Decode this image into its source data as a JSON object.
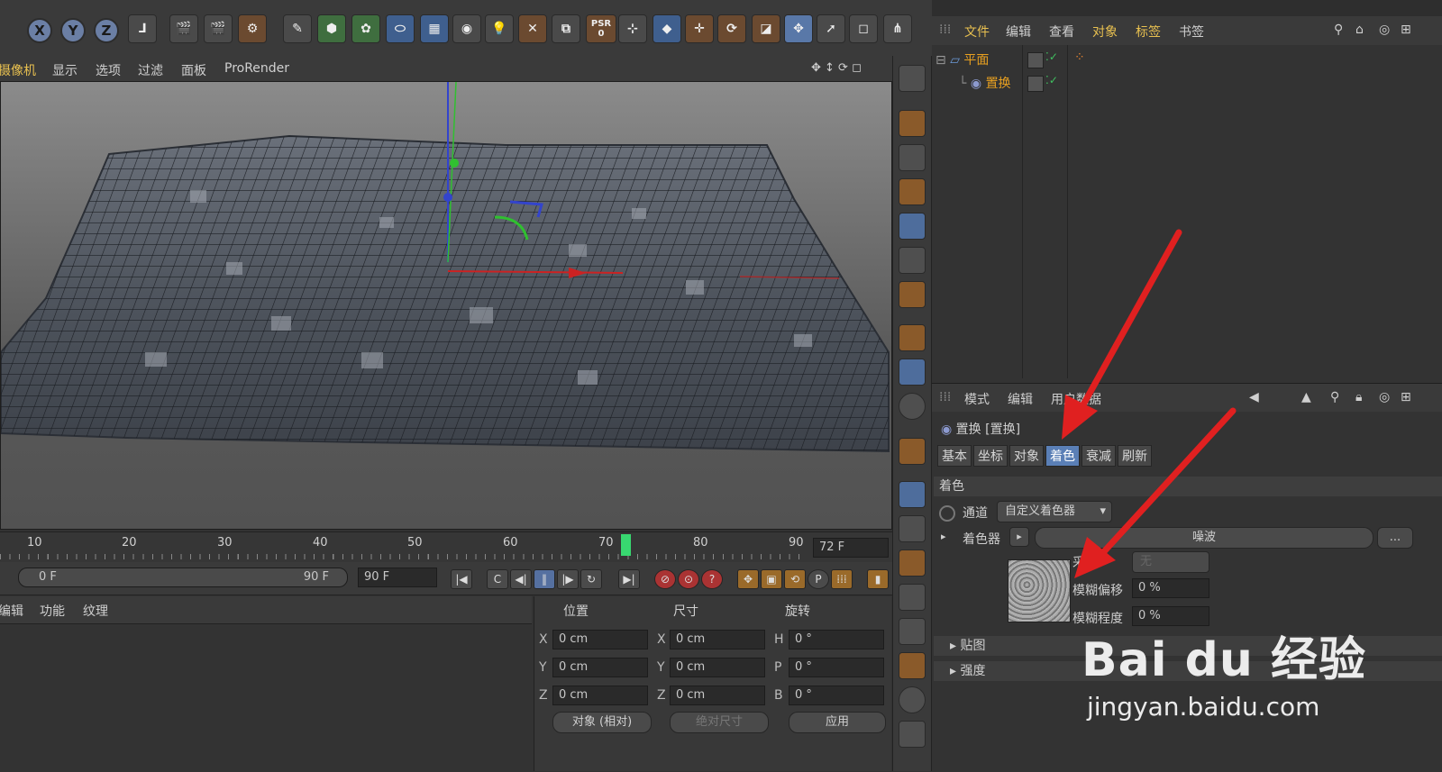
{
  "top_toolbar": {
    "axis_buttons": [
      "X",
      "Y",
      "Z"
    ],
    "psr_label": "PSR",
    "psr_value": "0",
    "tool_icons": [
      "coordinate-icon",
      "clapper-icon",
      "clapper-record-icon",
      "clapper-settings-icon",
      "pen-icon",
      "cube-green-icon",
      "flower-icon",
      "capsule-icon",
      "grid-icon",
      "camera-icon",
      "light-icon",
      "snap-icon",
      "uv-icon",
      "psr-icon",
      "xyz-axis-icon",
      "cube-blue-icon",
      "move-icon",
      "rotate-icon",
      "scale-icon",
      "move-alt-icon",
      "select-icon",
      "rect-select-icon",
      "hair-icon"
    ]
  },
  "viewport_menu": {
    "items": [
      "摄像机",
      "显示",
      "选项",
      "过滤",
      "面板",
      "ProRender"
    ]
  },
  "timeline": {
    "ticks": [
      "10",
      "20",
      "30",
      "40",
      "50",
      "60",
      "70",
      "80",
      "90"
    ],
    "playhead": 72,
    "current_frame": "72 F"
  },
  "transport": {
    "start_field": "0 F",
    "end_field": "90 F",
    "end_frame_field": "90 F",
    "buttons": [
      "|◀",
      "C",
      "◀|",
      "‖",
      "|▶",
      "↻",
      "▶|"
    ],
    "record_buttons": [
      "⊘",
      "⊙",
      "?"
    ],
    "key_buttons": [
      "✥",
      "▣",
      "⟲",
      "P",
      "⁞⁞⁞"
    ]
  },
  "material_menu": {
    "items": [
      "编辑",
      "功能",
      "纹理"
    ]
  },
  "coord_panel": {
    "headers": [
      "位置",
      "尺寸",
      "旋转"
    ],
    "rows": [
      {
        "a": "X",
        "pos": "0 cm",
        "b": "X",
        "size": "0 cm",
        "c": "H",
        "rot": "0 °"
      },
      {
        "a": "Y",
        "pos": "0 cm",
        "b": "Y",
        "size": "0 cm",
        "c": "P",
        "rot": "0 °"
      },
      {
        "a": "Z",
        "pos": "0 cm",
        "b": "Z",
        "size": "0 cm",
        "c": "B",
        "rot": "0 °"
      }
    ],
    "mode_combo": "对象 (相对)",
    "size_combo": "绝对尺寸",
    "apply_button": "应用"
  },
  "object_manager": {
    "menu": [
      "文件",
      "编辑",
      "查看",
      "对象",
      "标签",
      "书签"
    ],
    "objects": [
      {
        "name": "平面",
        "indent": 0,
        "color": "#e0a020"
      },
      {
        "name": "置换",
        "indent": 1,
        "color": "#e0a020"
      }
    ]
  },
  "attribute_manager": {
    "menu": [
      "模式",
      "编辑",
      "用户数据"
    ],
    "object_title": "置换 [置换]",
    "tabs": [
      "基本",
      "坐标",
      "对象",
      "着色",
      "衰减",
      "刷新"
    ],
    "active_tab": "着色",
    "section_title": "着色",
    "channel_label": "通道",
    "channel_value": "自定义着色器",
    "shader_label": "着色器",
    "shader_value": "噪波",
    "shader_more": "...",
    "sample_label": "采样",
    "sample_value": "无",
    "blur_offset_label": "模糊偏移",
    "blur_offset_value": "0 %",
    "blur_strength_label": "模糊程度",
    "blur_strength_value": "0 %",
    "collapsed_sections": [
      "贴图",
      "强度"
    ]
  },
  "watermark": {
    "brand": "Bai du 经验",
    "url": "jingyan.baidu.com"
  },
  "colors": {
    "accent": "#5a7fb6",
    "highlight_text": "#e8c050",
    "annotation_arrow": "#e02020"
  }
}
